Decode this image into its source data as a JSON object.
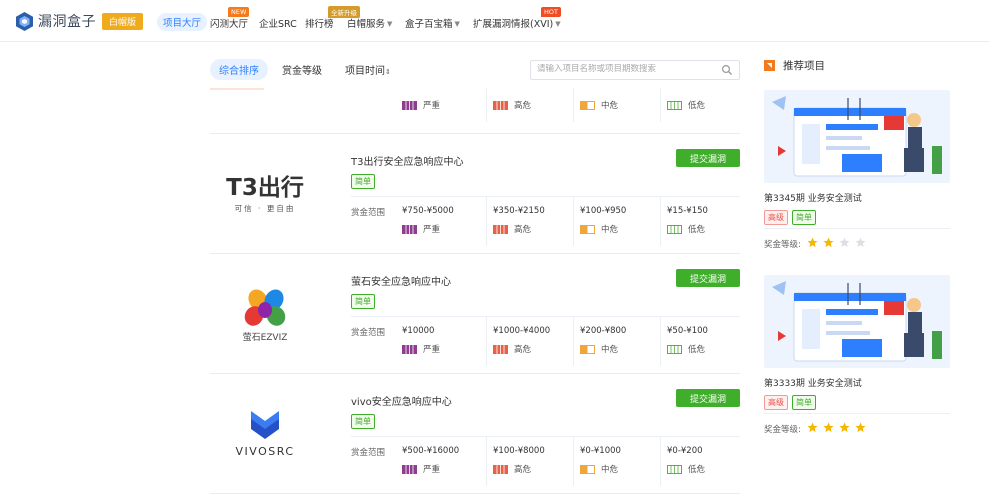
{
  "brand": {
    "name": "漏洞盒子",
    "edition": "白帽版"
  },
  "nav": {
    "items": [
      {
        "label": "项目大厅",
        "active": true
      },
      {
        "label": "闪测大厅"
      },
      {
        "label": "企业SRC"
      },
      {
        "label": "排行榜"
      },
      {
        "label": "白帽服务"
      },
      {
        "label": "盒子百宝箱"
      },
      {
        "label": "扩展漏洞情报(XVI)"
      }
    ],
    "badges": {
      "new": "NEW",
      "upgrade": "全新升级",
      "hot": "HOT"
    }
  },
  "filters": {
    "tabs": [
      {
        "label": "综合排序",
        "active": true
      },
      {
        "label": "赏金等级"
      },
      {
        "label": "项目时间"
      }
    ],
    "search_placeholder": "请输入项目名称或项目期数搜索"
  },
  "labels": {
    "submit": "提交漏洞",
    "range": "赏金范围",
    "levels": [
      "严重",
      "高危",
      "中危",
      "低危"
    ],
    "recommend_title": "推荐项目",
    "reward_level": "奖金等级:"
  },
  "projects": [
    {
      "partial": true,
      "ranges": [
        "",
        "",
        "",
        ""
      ]
    },
    {
      "name": "T3出行安全应急响应中心",
      "difficulty": "简单",
      "logo": "t3-logo",
      "logo_text": "T3出行",
      "logo_slogan": "可信 · 更自由",
      "ranges": [
        "¥750-¥5000",
        "¥350-¥2150",
        "¥100-¥950",
        "¥15-¥150"
      ]
    },
    {
      "name": "萤石安全应急响应中心",
      "difficulty": "简单",
      "logo": "ezviz-logo",
      "logo_text": "萤石EZVIZ",
      "ranges": [
        "¥10000",
        "¥1000-¥4000",
        "¥200-¥800",
        "¥50-¥100"
      ]
    },
    {
      "name": "vivo安全应急响应中心",
      "difficulty": "简单",
      "logo": "vivosrc-logo",
      "logo_text": "VIVOSRC",
      "ranges": [
        "¥500-¥16000",
        "¥100-¥8000",
        "¥0-¥1000",
        "¥0-¥200"
      ]
    }
  ],
  "recommended": [
    {
      "title": "第3345期 业务安全测试",
      "tags": [
        "高级",
        "简单"
      ],
      "stars": 2,
      "star_total": 4
    },
    {
      "title": "第3333期 业务安全测试",
      "tags": [
        "高级",
        "简单"
      ],
      "stars": 4,
      "star_total": 4
    }
  ],
  "colors": {
    "accent": "#2d7fff",
    "green": "#3fae2a",
    "critical": "#8e3d8f",
    "high": "#e8624a",
    "medium": "#f0a63a",
    "low": "#58b23b",
    "star_on": "#f5b800",
    "star_off": "#dcdfe4"
  }
}
